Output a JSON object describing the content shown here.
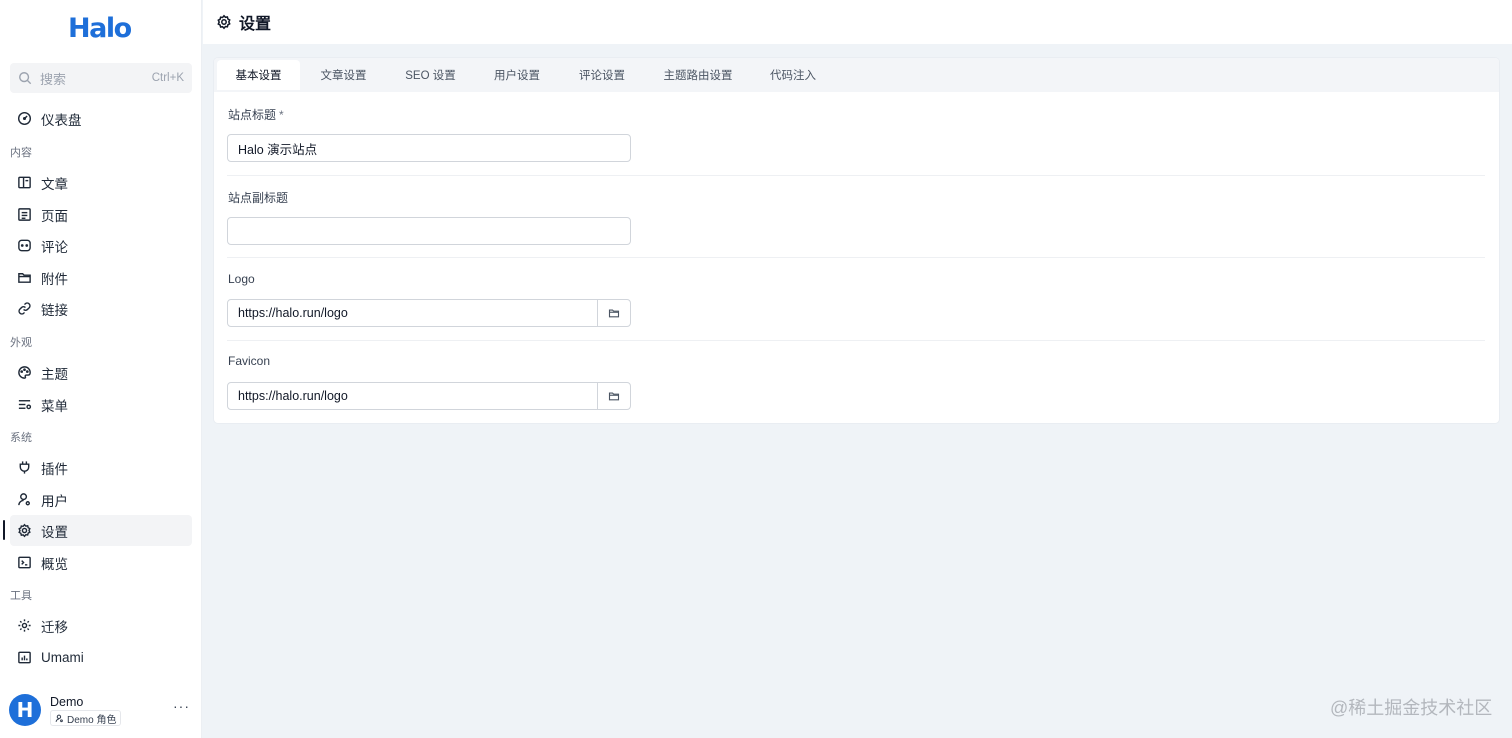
{
  "brand": {
    "logo_text": "Halo"
  },
  "search": {
    "placeholder": "搜索",
    "shortcut": "Ctrl+K",
    "icon": "search-icon"
  },
  "sidebar": {
    "dashboard": {
      "label": "仪表盘",
      "icon": "gauge-icon"
    },
    "groups": [
      {
        "label": "内容",
        "items": [
          {
            "label": "文章",
            "icon": "book-icon"
          },
          {
            "label": "页面",
            "icon": "page-icon"
          },
          {
            "label": "评论",
            "icon": "comment-icon"
          },
          {
            "label": "附件",
            "icon": "folder-icon"
          },
          {
            "label": "链接",
            "icon": "link-icon"
          }
        ]
      },
      {
        "label": "外观",
        "items": [
          {
            "label": "主题",
            "icon": "palette-icon"
          },
          {
            "label": "菜单",
            "icon": "menu-icon"
          }
        ]
      },
      {
        "label": "系统",
        "items": [
          {
            "label": "插件",
            "icon": "plug-icon"
          },
          {
            "label": "用户",
            "icon": "user-icon"
          },
          {
            "label": "设置",
            "icon": "gear-icon",
            "active": true
          },
          {
            "label": "概览",
            "icon": "terminal-icon"
          }
        ]
      },
      {
        "label": "工具",
        "items": [
          {
            "label": "迁移",
            "icon": "cog-icon"
          },
          {
            "label": "Umami",
            "icon": "chart-icon"
          }
        ]
      }
    ]
  },
  "user": {
    "avatar_letter": "H",
    "name": "Demo",
    "role": "Demo 角色",
    "more": "···"
  },
  "header": {
    "title": "设置",
    "icon": "gear-icon"
  },
  "tabs": [
    {
      "label": "基本设置",
      "active": true
    },
    {
      "label": "文章设置"
    },
    {
      "label": "SEO 设置"
    },
    {
      "label": "用户设置"
    },
    {
      "label": "评论设置"
    },
    {
      "label": "主题路由设置"
    },
    {
      "label": "代码注入"
    }
  ],
  "form": {
    "site_title": {
      "label": "站点标题",
      "required_mark": "*",
      "value": "Halo 演示站点"
    },
    "site_subtitle": {
      "label": "站点副标题",
      "value": ""
    },
    "logo": {
      "label": "Logo",
      "value": "https://halo.run/logo",
      "button_icon": "folder-icon"
    },
    "favicon": {
      "label": "Favicon",
      "value": "https://halo.run/logo",
      "button_icon": "folder-icon"
    }
  },
  "watermark": "@稀土掘金技术社区",
  "colors": {
    "brand": "#1e6fd9",
    "background": "#eff3f7"
  }
}
